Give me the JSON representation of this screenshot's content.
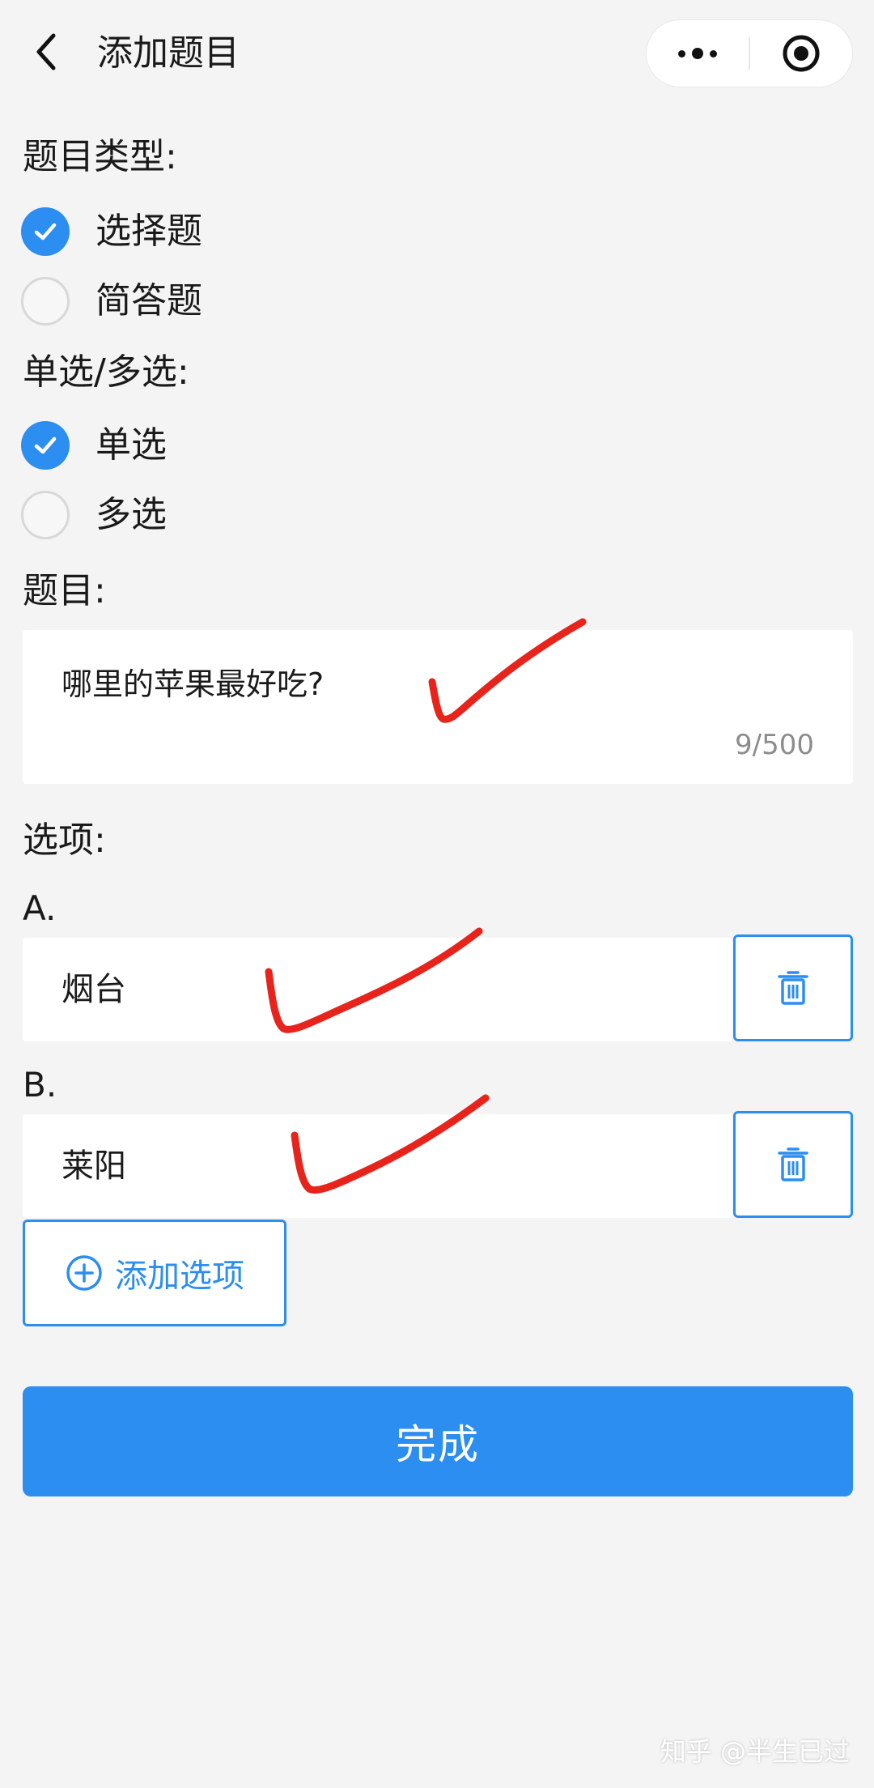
{
  "nav": {
    "title": "添加题目",
    "more_icon": "more-dots-icon",
    "close_icon": "target-close-icon"
  },
  "question_type": {
    "label": "题目类型:",
    "options": [
      {
        "label": "选择题",
        "selected": true
      },
      {
        "label": "简答题",
        "selected": false
      }
    ]
  },
  "select_mode": {
    "label": "单选/多选:",
    "options": [
      {
        "label": "单选",
        "selected": true
      },
      {
        "label": "多选",
        "selected": false
      }
    ]
  },
  "question": {
    "label": "题目:",
    "value": "哪里的苹果最好吃?",
    "counter": "9/500"
  },
  "options": {
    "label": "选项:",
    "items": [
      {
        "letter": "A.",
        "value": "烟台",
        "delete_icon": "trash-icon"
      },
      {
        "letter": "B.",
        "value": "莱阳",
        "delete_icon": "trash-icon"
      }
    ],
    "add_label": "添加选项"
  },
  "submit": {
    "label": "完成"
  },
  "watermark": "知乎 @半生已过",
  "colors": {
    "accent": "#2b8ef0",
    "background": "#f4f4f5",
    "annotation": "#e8231b"
  }
}
